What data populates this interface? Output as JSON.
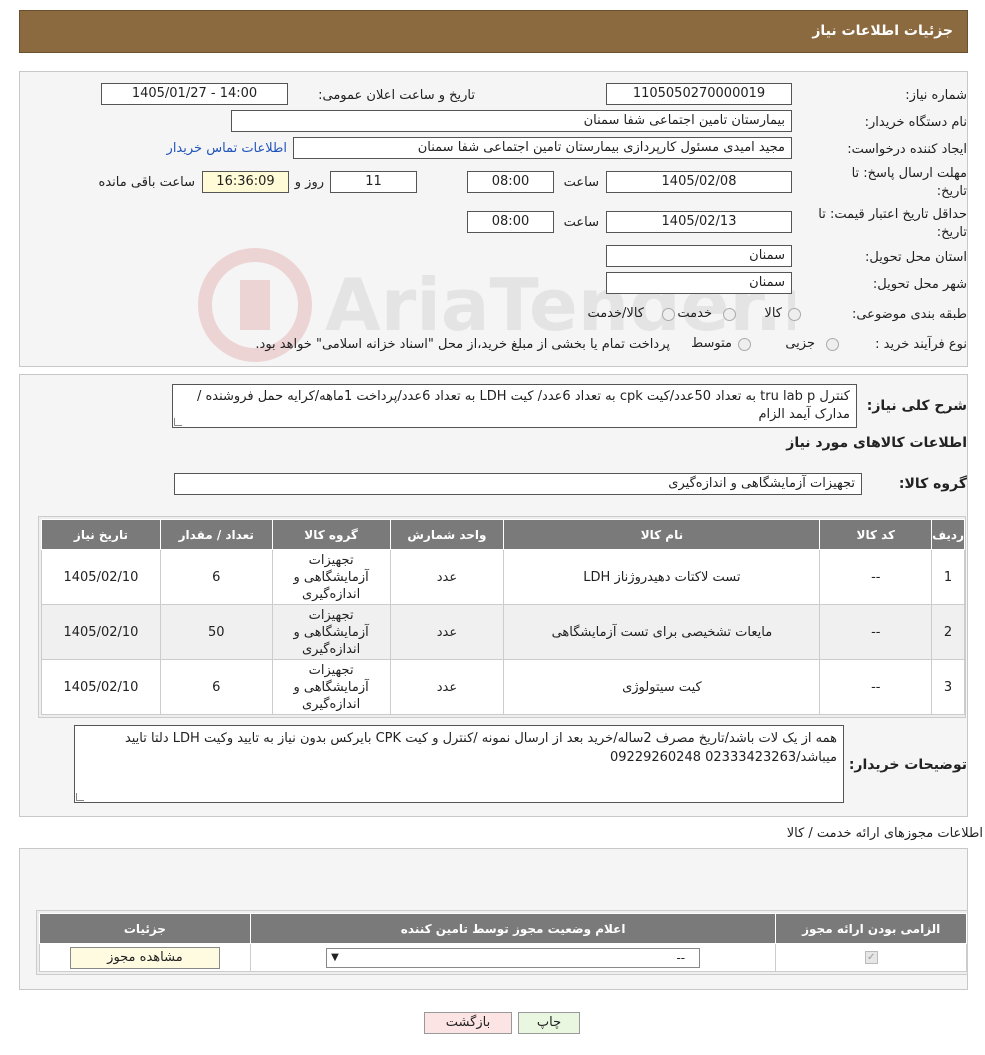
{
  "header": {
    "title": "جزئیات اطلاعات نیاز"
  },
  "fields": {
    "need_number_label": "شماره نیاز:",
    "need_number": "1105050270000019",
    "announce_label": "تاریخ و ساعت اعلان عمومی:",
    "announce_value": "1405/01/27 - 14:00",
    "buyer_label": "نام دستگاه خریدار:",
    "buyer_value": "بیمارستان تامین اجتماعی شفا سمنان",
    "creator_label": "ایجاد کننده درخواست:",
    "creator_value": "مجید امیدی مسئول کارپردازی بیمارستان تامین اجتماعی شفا سمنان",
    "contact_link": "اطلاعات تماس خریدار",
    "deadline_label_1": "مهلت ارسال پاسخ: تا",
    "deadline_label_2": "تاریخ:",
    "deadline_date": "1405/02/08",
    "time_label": "ساعت",
    "deadline_time": "08:00",
    "days_value": "11",
    "days_label": "روز و",
    "remaining_time": "16:36:09",
    "remaining_label": "ساعت باقی مانده",
    "validity_label_1": "حداقل تاریخ اعتبار قیمت: تا",
    "validity_label_2": "تاریخ:",
    "validity_date": "1405/02/13",
    "validity_time": "08:00",
    "province_label": "استان محل تحویل:",
    "province_value": "سمنان",
    "city_label": "شهر محل تحویل:",
    "city_value": "سمنان",
    "category_label": "طبقه بندی موضوعی:",
    "category_options": [
      "کالا",
      "خدمت",
      "کالا/خدمت"
    ],
    "process_label": "نوع فرآیند خرید :",
    "process_options": [
      "جزیی",
      "متوسط"
    ],
    "process_note": "پرداخت تمام یا بخشی از مبلغ خرید،از محل \"اسناد خزانه اسلامی\" خواهد بود."
  },
  "description": {
    "label": "شرح کلی نیاز:",
    "text": "کنترل tru lab p  به تعداد 50عدد/کیت cpk به تعداد 6عدد/ کیت LDH به تعداد 6عدد/پرداخت 1ماهه/کرایه حمل فروشنده /مدارک آیمد الزام"
  },
  "goods": {
    "section_title": "اطلاعات کالاهای مورد نیاز",
    "group_label": "گروه کالا:",
    "group_value": "تجهیزات آزمایشگاهی و اندازه‌گیری",
    "columns": [
      "ردیف",
      "کد کالا",
      "نام کالا",
      "واحد شمارش",
      "گروه کالا",
      "تعداد / مقدار",
      "تاریخ نیاز"
    ],
    "rows": [
      {
        "idx": "1",
        "code": "--",
        "name": "تست لاکتات دهیدروژناز LDH",
        "unit": "عدد",
        "group": "تجهیزات آزمایشگاهی و اندازه‌گیری",
        "qty": "6",
        "date": "1405/02/10"
      },
      {
        "idx": "2",
        "code": "--",
        "name": "مایعات تشخیصی برای تست آزمایشگاهی",
        "unit": "عدد",
        "group": "تجهیزات آزمایشگاهی و اندازه‌گیری",
        "qty": "50",
        "date": "1405/02/10"
      },
      {
        "idx": "3",
        "code": "--",
        "name": "کیت سیتولوژی",
        "unit": "عدد",
        "group": "تجهیزات آزمایشگاهی و اندازه‌گیری",
        "qty": "6",
        "date": "1405/02/10"
      }
    ]
  },
  "buyer_notes": {
    "label": "توضیحات خریدار:",
    "text": "همه از یک لات باشد/تاریخ مصرف 2ساله/خرید بعد از ارسال نمونه /کنترل و کیت CPK بایرکس بدون نیاز به تایید وکیت LDH دلتا تایید میباشد/02333423263   09229260248"
  },
  "permits": {
    "section_title": "اطلاعات مجوزهای ارائه خدمت / کالا",
    "columns": [
      "الزامی بودن ارائه مجوز",
      "اعلام وضعیت مجوز توسط تامین کننده",
      "جزئیات"
    ],
    "select_value": "--",
    "view_button": "مشاهده مجوز"
  },
  "buttons": {
    "print": "چاپ",
    "back": "بازگشت"
  },
  "colors": {
    "header": "#8b6a3f",
    "table_head": "#7a7a7a",
    "link": "#2255bb"
  }
}
